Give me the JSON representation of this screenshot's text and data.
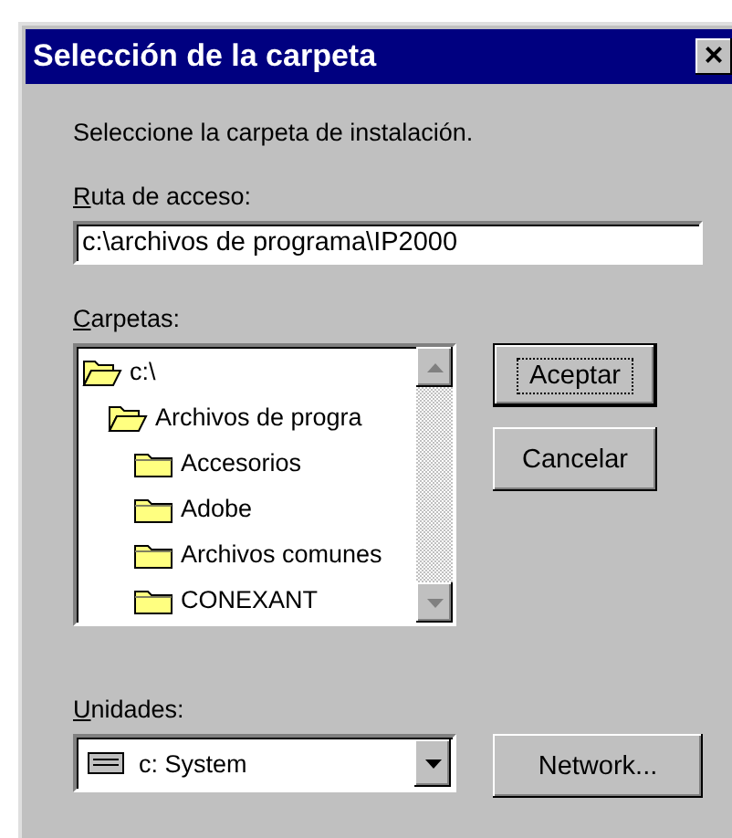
{
  "window": {
    "title": "Selección de la carpeta",
    "close": "×"
  },
  "prompt": "Seleccione la carpeta de instalación.",
  "path": {
    "label": "Ruta de acceso:",
    "value": "c:\\archivos de programa\\IP2000"
  },
  "folders": {
    "label": "Carpetas:",
    "tree": [
      {
        "name": "c:\\",
        "expanded": true,
        "children": [
          {
            "name": "Archivos de progra",
            "expanded": true,
            "children": [
              {
                "name": "Accesorios",
                "expanded": false
              },
              {
                "name": "Adobe",
                "expanded": false
              },
              {
                "name": "Archivos comunes",
                "expanded": false
              },
              {
                "name": "CONEXANT",
                "expanded": false
              }
            ]
          }
        ]
      }
    ]
  },
  "buttons": [
    {
      "label": "Aceptar",
      "default": true
    },
    {
      "label": "Cancelar",
      "default": false
    }
  ],
  "drives": {
    "label": "Unidades:",
    "value": "c: System"
  },
  "network_button": "Network..."
}
